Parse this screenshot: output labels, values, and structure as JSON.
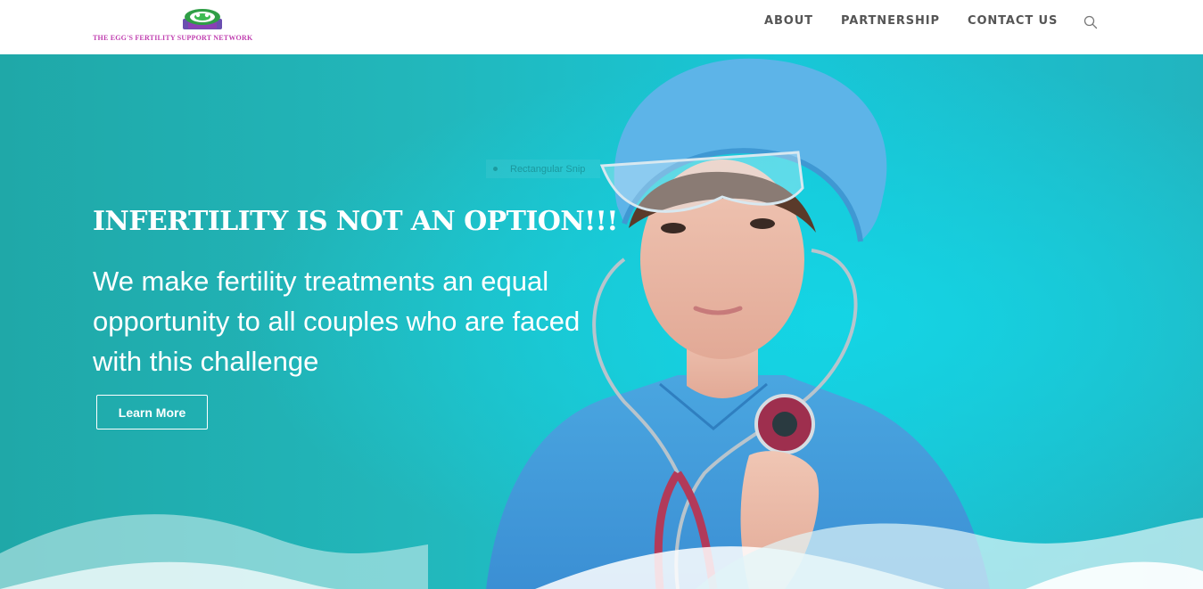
{
  "brand": {
    "logo_icon": "eggs-logo-icon",
    "name": "THE EGG'S FERTILITY SUPPORT NETWORK",
    "text_color": "#c03fb0"
  },
  "nav": {
    "items": [
      {
        "label": "ABOUT"
      },
      {
        "label": "PARTNERSHIP"
      },
      {
        "label": "CONTACT US"
      }
    ],
    "search_icon": "search-icon"
  },
  "hero": {
    "overlay_tooltip": "Rectangular Snip",
    "heading": "INFERTILITY IS NOT AN OPTION!!!",
    "subheading": "We make fertility treatments an equal opportunity to all couples who are faced with this challenge",
    "cta_label": "Learn More",
    "image": "doctor-with-stethoscope-photo"
  },
  "colors": {
    "hero_bg": "#1fb4b8",
    "accent": "#17c7d8",
    "nav_text": "#555555"
  }
}
